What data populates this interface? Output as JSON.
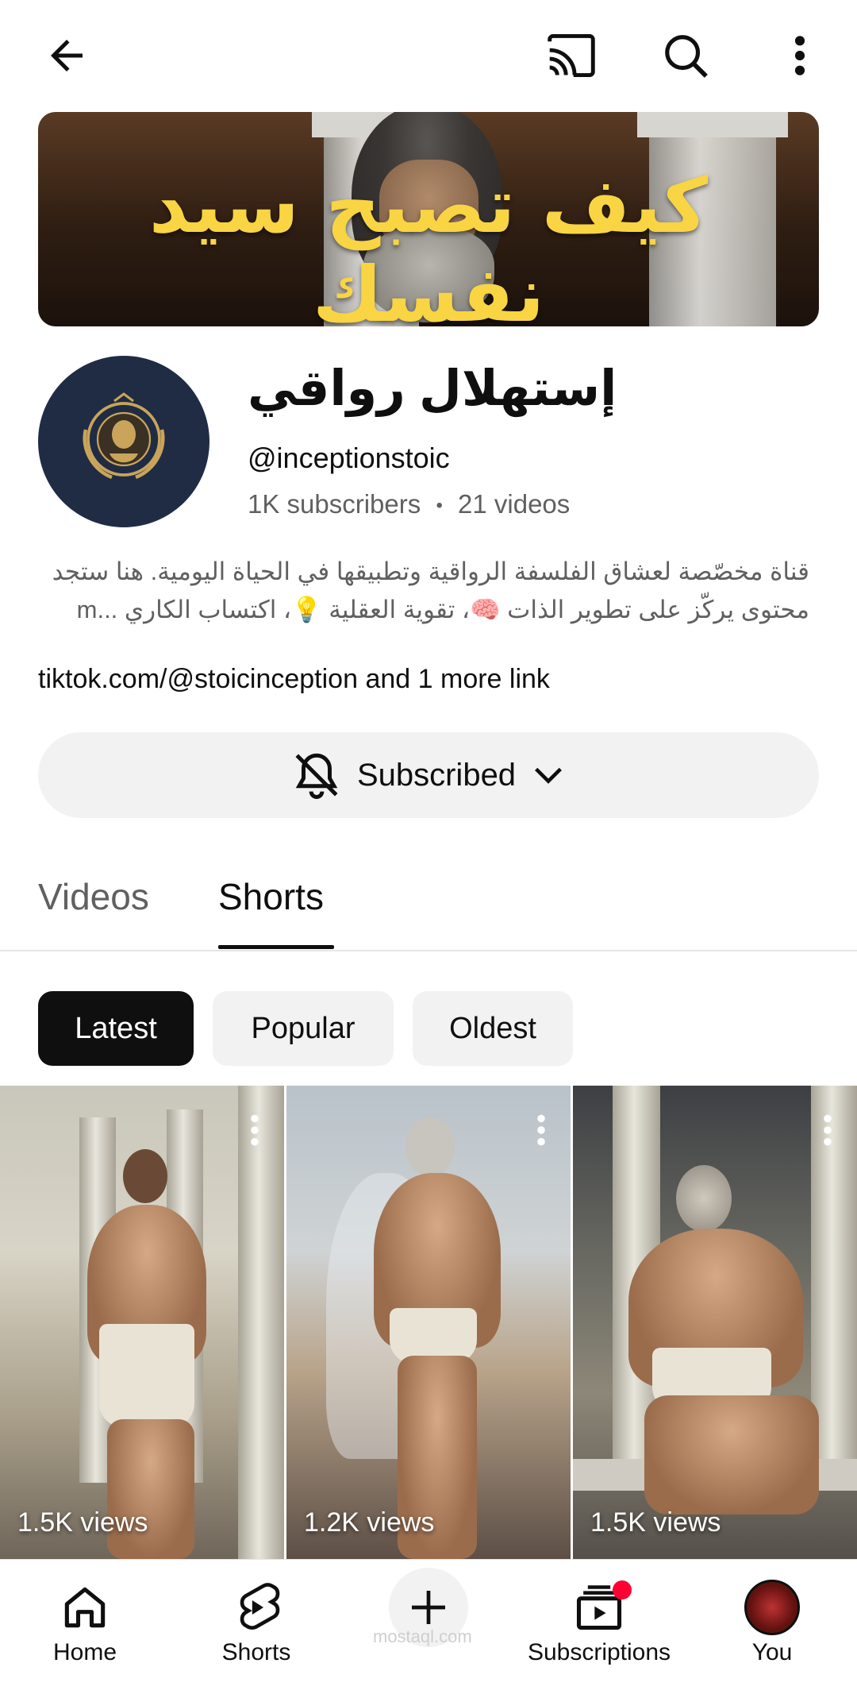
{
  "header": {
    "back_icon": "back-arrow-icon",
    "cast_icon": "cast-icon",
    "search_icon": "search-icon",
    "more_icon": "more-vert-icon"
  },
  "banner": {
    "title": "كيف تصبح سيد نفسك",
    "title_color": "#f9d443"
  },
  "channel": {
    "name": "إستهلال رواقي",
    "handle": "@inceptionstoic",
    "subscribers": "1K subscribers",
    "separator": "•",
    "videos": "21 videos",
    "description_line1": "قناة مخصّصة لعشاق الفلسفة الرواقية وتطبيقها في الحياة اليومية. هنا ستجد",
    "description_line2": "محتوى يركّز على تطوير الذات 🧠، تقوية العقلية 💡، اكتساب الكاري ...m",
    "link": "tiktok.com/@stoicinception",
    "link_more": " and 1 more link"
  },
  "subscribe": {
    "label": "Subscribed",
    "bell_icon": "bell-off-icon",
    "chevron_icon": "chevron-down-icon"
  },
  "tabs": [
    {
      "label": "Videos",
      "selected": false
    },
    {
      "label": "Shorts",
      "selected": true
    }
  ],
  "chips": [
    {
      "label": "Latest",
      "selected": true
    },
    {
      "label": "Popular",
      "selected": false
    },
    {
      "label": "Oldest",
      "selected": false
    }
  ],
  "shorts": [
    {
      "views": "1.5K views"
    },
    {
      "views": "1.2K views"
    },
    {
      "views": "1.5K views"
    }
  ],
  "bottom_nav": [
    {
      "label": "Home",
      "icon": "home-icon"
    },
    {
      "label": "Shorts",
      "icon": "shorts-icon"
    },
    {
      "label": "",
      "icon": "create-plus-icon"
    },
    {
      "label": "Subscriptions",
      "icon": "subscriptions-icon"
    },
    {
      "label": "You",
      "icon": "avatar"
    }
  ],
  "watermark": "mostaql.com",
  "colors": {
    "accent_red": "#ff0033",
    "chip_selected_bg": "#0f0f0f",
    "muted_text": "#606060"
  }
}
